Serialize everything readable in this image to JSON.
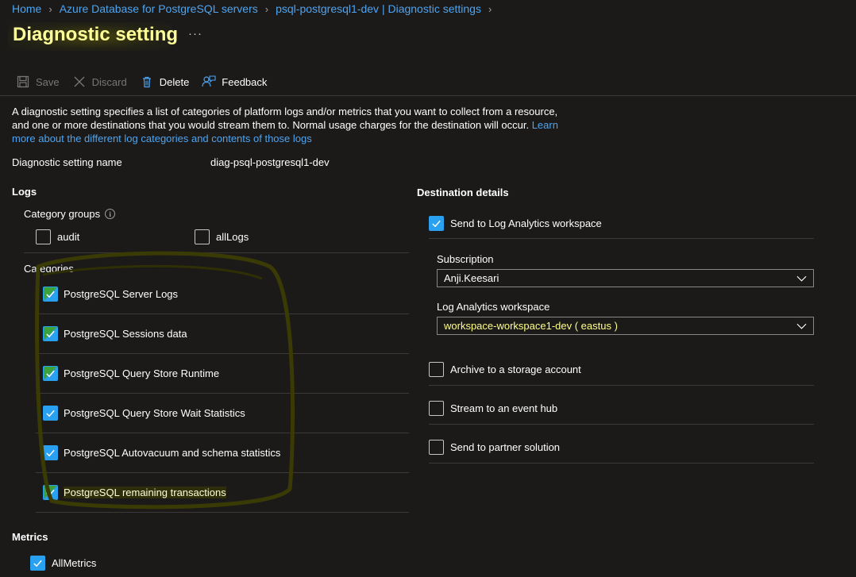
{
  "breadcrumb": {
    "items": [
      "Home",
      "Azure Database for PostgreSQL servers",
      "psql-postgresql1-dev | Diagnostic settings"
    ]
  },
  "page": {
    "title": "Diagnostic setting",
    "more": "···"
  },
  "toolbar": {
    "save": "Save",
    "discard": "Discard",
    "delete": "Delete",
    "feedback": "Feedback"
  },
  "description": {
    "text": "A diagnostic setting specifies a list of categories of platform logs and/or metrics that you want to collect from a resource, and one or more destinations that you would stream them to. Normal usage charges for the destination will occur. ",
    "link": "Learn more about the different log categories and contents of those logs"
  },
  "setting_name": {
    "label": "Diagnostic setting name",
    "value": "diag-psql-postgresql1-dev"
  },
  "logs": {
    "title": "Logs",
    "category_groups_label": "Category groups",
    "groups": [
      {
        "label": "audit",
        "checked": false
      },
      {
        "label": "allLogs",
        "checked": false
      }
    ],
    "categories_label": "Categories",
    "categories": [
      {
        "label": "PostgreSQL Server Logs",
        "checked": true
      },
      {
        "label": "PostgreSQL Sessions data",
        "checked": true
      },
      {
        "label": "PostgreSQL Query Store Runtime",
        "checked": true
      },
      {
        "label": "PostgreSQL Query Store Wait Statistics",
        "checked": true
      },
      {
        "label": "PostgreSQL Autovacuum and schema statistics",
        "checked": true
      },
      {
        "label": "PostgreSQL remaining transactions",
        "checked": true
      }
    ]
  },
  "metrics": {
    "title": "Metrics",
    "items": [
      {
        "label": "AllMetrics",
        "checked": true
      }
    ]
  },
  "destination": {
    "title": "Destination details",
    "log_analytics": {
      "label": "Send to Log Analytics workspace",
      "checked": true
    },
    "subscription_label": "Subscription",
    "subscription_value": "Anji.Keesari",
    "workspace_label": "Log Analytics workspace",
    "workspace_value": "workspace-workspace1-dev ( eastus )",
    "archive": {
      "label": "Archive to a storage account",
      "checked": false
    },
    "event_hub": {
      "label": "Stream to an event hub",
      "checked": false
    },
    "partner": {
      "label": "Send to partner solution",
      "checked": false
    }
  },
  "colors": {
    "background": "#1b1a19",
    "link": "#4ea4f0",
    "checkbox_checked": "#2aa0f0",
    "highlight": "#ffff40"
  }
}
